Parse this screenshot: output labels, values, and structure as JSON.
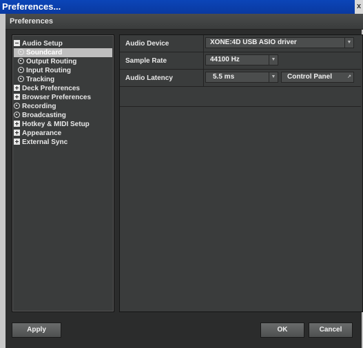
{
  "window": {
    "title": "Preferences...",
    "close": "x"
  },
  "header": {
    "title": "Preferences"
  },
  "tree": [
    {
      "label": "Audio Setup",
      "icon": "minus-box-icon"
    },
    {
      "label": "Soundcard",
      "icon": "radio-icon",
      "selected": true
    },
    {
      "label": "Output Routing",
      "icon": "radio-icon"
    },
    {
      "label": "Input Routing",
      "icon": "radio-icon"
    },
    {
      "label": "Tracking",
      "icon": "radio-icon"
    },
    {
      "label": "Deck Preferences",
      "icon": "plus-box-icon"
    },
    {
      "label": "Browser Preferences",
      "icon": "plus-box-icon"
    },
    {
      "label": "Recording",
      "icon": "radio-icon"
    },
    {
      "label": "Broadcasting",
      "icon": "radio-icon"
    },
    {
      "label": "Hotkey & MIDI Setup",
      "icon": "plus-box-icon"
    },
    {
      "label": "Appearance",
      "icon": "plus-box-icon"
    },
    {
      "label": "External Sync",
      "icon": "plus-box-icon"
    }
  ],
  "settings": {
    "audio_device": {
      "label": "Audio Device",
      "value": "XONE:4D USB ASIO driver"
    },
    "sample_rate": {
      "label": "Sample Rate",
      "value": "44100 Hz"
    },
    "audio_latency": {
      "label": "Audio Latency",
      "value": "5.5 ms",
      "control_panel": "Control Panel"
    }
  },
  "buttons": {
    "apply": "Apply",
    "ok": "OK",
    "cancel": "Cancel"
  }
}
